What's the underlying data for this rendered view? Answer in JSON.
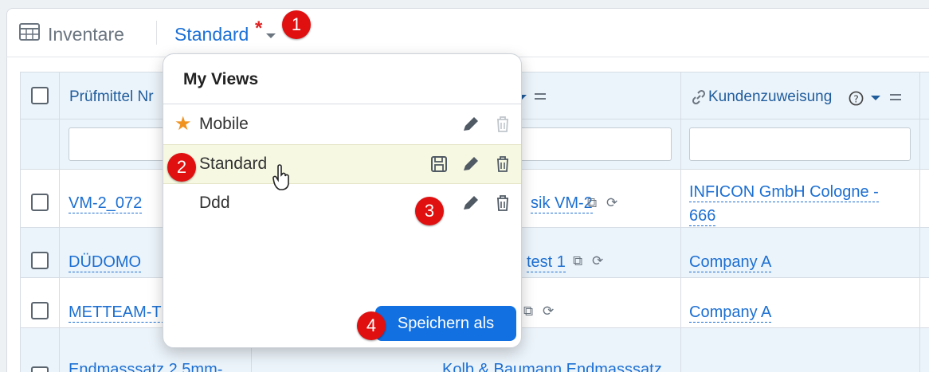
{
  "header": {
    "title": "Inventare",
    "view_label": "Standard",
    "modified_marker": "*",
    "title_icon": "table-icon"
  },
  "markers": [
    "1",
    "2",
    "3",
    "4"
  ],
  "table": {
    "columns": [
      "Prüfmittel Nr",
      "Kundenzuweisung"
    ],
    "rows": [
      {
        "id": "VM-2_072",
        "product": "sik VM-2",
        "customer_line1": "INFICON GmbH Cologne -",
        "customer_line2": "666"
      },
      {
        "id": "DÜDOMO",
        "product": "test 1",
        "customer_line1": "Company A",
        "customer_line2": ""
      },
      {
        "id": "METTEAM-TE",
        "product": "",
        "customer_line1": "Company A",
        "customer_line2": ""
      },
      {
        "id": "Endmasssatz 2,5mm-",
        "product": "Kolb & Baumann Endmasssatz",
        "customer_line1": "",
        "customer_line2": ""
      }
    ]
  },
  "popup": {
    "title": "My Views",
    "items": [
      {
        "label": "Mobile",
        "favorite": true
      },
      {
        "label": "Standard",
        "favorite": false
      },
      {
        "label": "Ddd",
        "favorite": false
      }
    ],
    "save_as_label": "Speichern als"
  },
  "colors": {
    "accent": "#1270e0",
    "link": "#1c6fd2",
    "marker": "#e01010",
    "active_row": "#f7f8e2"
  }
}
